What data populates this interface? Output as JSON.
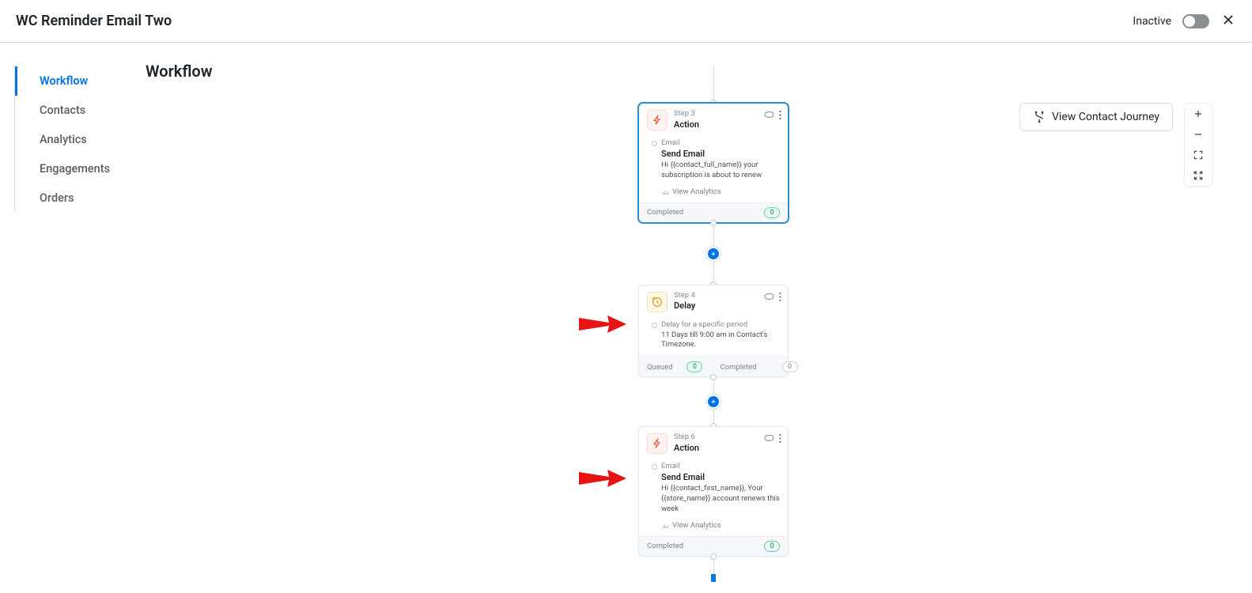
{
  "header": {
    "title": "WC Reminder Email Two",
    "status_label": "Inactive"
  },
  "sidebar": {
    "items": [
      {
        "label": "Workflow",
        "active": true
      },
      {
        "label": "Contacts",
        "active": false
      },
      {
        "label": "Analytics",
        "active": false
      },
      {
        "label": "Engagements",
        "active": false
      },
      {
        "label": "Orders",
        "active": false
      }
    ]
  },
  "main": {
    "title": "Workflow",
    "journey_button": "View Contact Journey"
  },
  "flow": {
    "node1": {
      "step": "Step 3",
      "type": "Action",
      "subtype": "Email",
      "action_title": "Send Email",
      "desc": "Hi {{contact_full_name}} your subscription is about to renew",
      "analytics": "View Analytics",
      "footer_completed": "Completed",
      "footer_completed_count": "0"
    },
    "node2": {
      "step": "Step 4",
      "type": "Delay",
      "action_title": "Delay for a specific period",
      "desc": "11 Days till 9:00 am in Contact's Timezone.",
      "footer_queued": "Queued",
      "footer_queued_count": "0",
      "footer_completed": "Completed",
      "footer_completed_count": "0"
    },
    "node3": {
      "step": "Step 6",
      "type": "Action",
      "subtype": "Email",
      "action_title": "Send Email",
      "desc": "Hi {{contact_first_name}}, Your {{store_name}} account renews this week",
      "analytics": "View Analytics",
      "footer_completed": "Completed",
      "footer_completed_count": "0"
    }
  }
}
